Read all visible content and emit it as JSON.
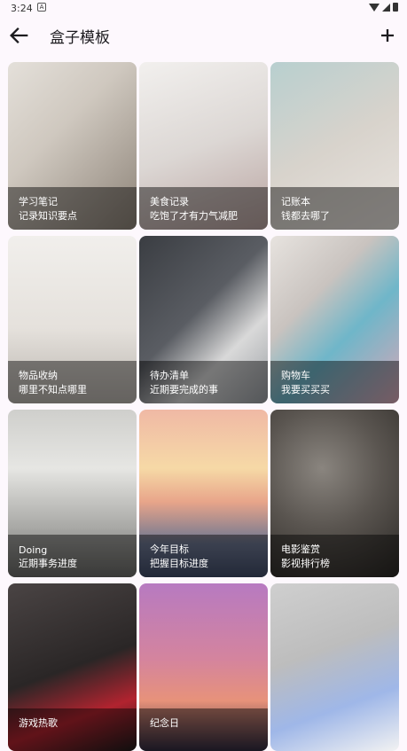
{
  "status": {
    "time": "3:24",
    "a_label": "A"
  },
  "app_bar": {
    "title": "盒子模板"
  },
  "cards": [
    {
      "title": "学习笔记",
      "subtitle": "记录知识要点"
    },
    {
      "title": "美食记录",
      "subtitle": "吃饱了才有力气减肥"
    },
    {
      "title": "记账本",
      "subtitle": "钱都去哪了"
    },
    {
      "title": "物品收纳",
      "subtitle": "哪里不知点哪里"
    },
    {
      "title": "待办清单",
      "subtitle": "近期要完成的事"
    },
    {
      "title": "购物车",
      "subtitle": "我要买买买"
    },
    {
      "title": "Doing",
      "subtitle": "近期事务进度"
    },
    {
      "title": "今年目标",
      "subtitle": "把握目标进度"
    },
    {
      "title": "电影鉴赏",
      "subtitle": "影视排行榜"
    },
    {
      "title": "游戏热歌",
      "subtitle": ""
    },
    {
      "title": "纪念日",
      "subtitle": ""
    },
    {
      "title": "",
      "subtitle": ""
    }
  ],
  "colors": {
    "background": "#fdf8fd",
    "overlay": "rgba(0,0,0,0.45)"
  },
  "icons": {
    "back": "arrow-left-icon",
    "add": "plus-icon"
  }
}
